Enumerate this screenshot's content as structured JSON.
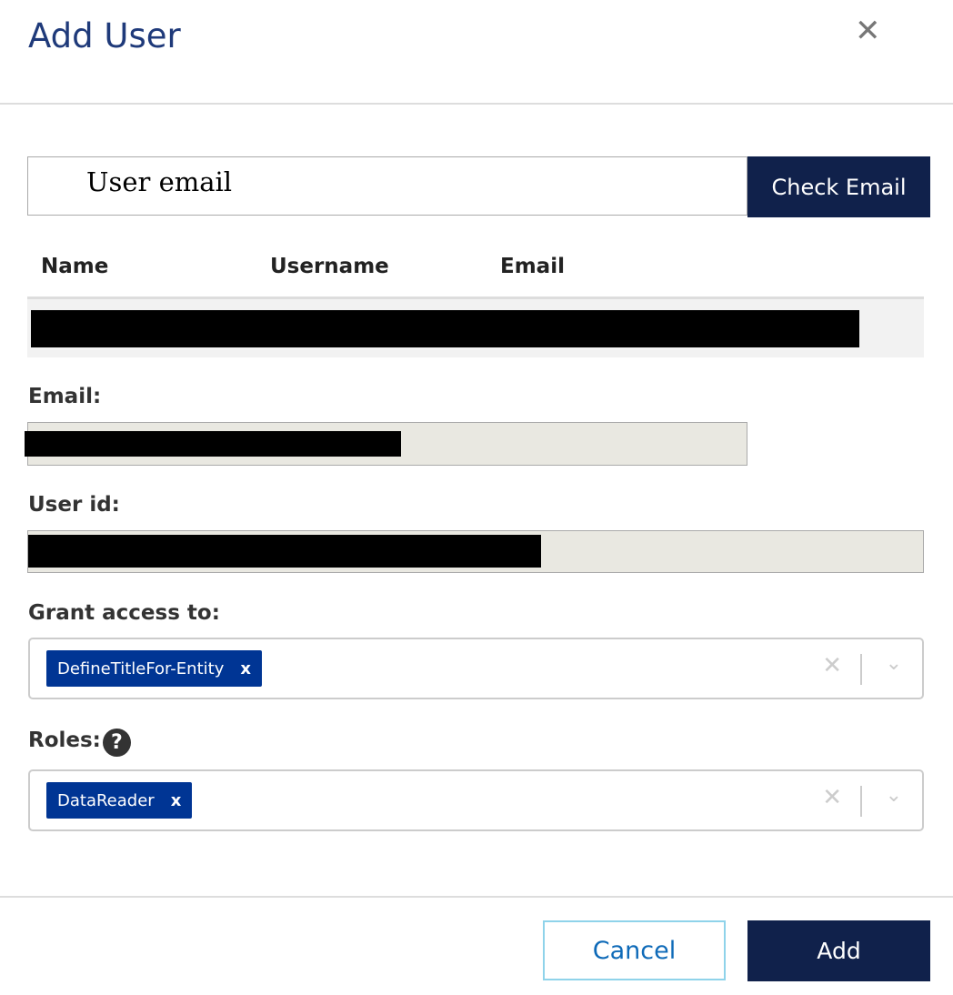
{
  "dialog": {
    "title": "Add User",
    "close_icon": "close-icon"
  },
  "search": {
    "placeholder": "User email",
    "check_label": "Check Email"
  },
  "table": {
    "headers": [
      "Name",
      "Username",
      "Email"
    ]
  },
  "fields": {
    "email_label": "Email:",
    "user_id_label": "User id:",
    "grant_label": "Grant access to:",
    "roles_label": "Roles:"
  },
  "grant": {
    "chips": [
      "DefineTitleFor-Entity"
    ]
  },
  "roles": {
    "chips": [
      "DataReader"
    ]
  },
  "chip_remove": "x",
  "clear_glyph": "✕",
  "chevron_glyph": "⌄",
  "help_glyph": "?",
  "footer": {
    "cancel": "Cancel",
    "add": "Add"
  },
  "colors": {
    "primary": "#10214b",
    "chip": "#003594",
    "title": "#1f3a7a"
  }
}
